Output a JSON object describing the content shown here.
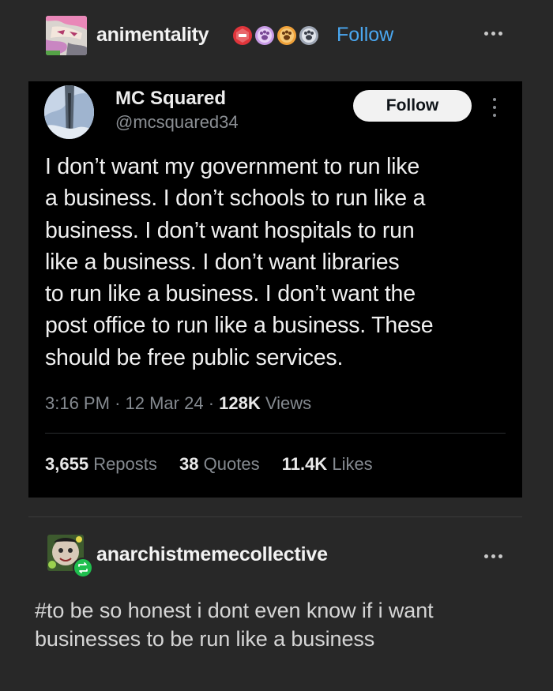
{
  "post": {
    "blog_name": "animentality",
    "follow_label": "Follow",
    "badges": [
      {
        "icon": "red-badge-icon",
        "color": "#e0353b"
      },
      {
        "icon": "paw-badge-icon",
        "color": "#c89be6"
      },
      {
        "icon": "paw-badge-icon",
        "color": "#f0a23a"
      },
      {
        "icon": "paw-badge-icon",
        "color": "#9fa7b5"
      }
    ]
  },
  "tweet": {
    "author_name": "MC Squared",
    "handle": "@mcsquared34",
    "follow_label": "Follow",
    "lines": [
      "I don’t want my government to run like",
      "a business. I don’t schools to run like a",
      "business. I don’t want hospitals to run",
      "like a business. I don’t want libraries",
      "to run like a business. I don’t want the",
      "post office to run like a business. These",
      "should be free public services."
    ],
    "time": "3:16 PM",
    "date": "12 Mar 24",
    "views_count": "128K",
    "views_label": "Views",
    "reposts_count": "3,655",
    "reposts_label": "Reposts",
    "quotes_count": "38",
    "quotes_label": "Quotes",
    "likes_count": "11.4K",
    "likes_label": "Likes"
  },
  "reblog": {
    "blog_name": "anarchistmemecollective",
    "text": "#to be so honest i dont even know if i want businesses to be run like a business"
  },
  "colors": {
    "background": "#282828",
    "tweet_background": "#000000",
    "follow_link": "#4aa7f0",
    "reblog_badge": "#1fbf4e"
  }
}
